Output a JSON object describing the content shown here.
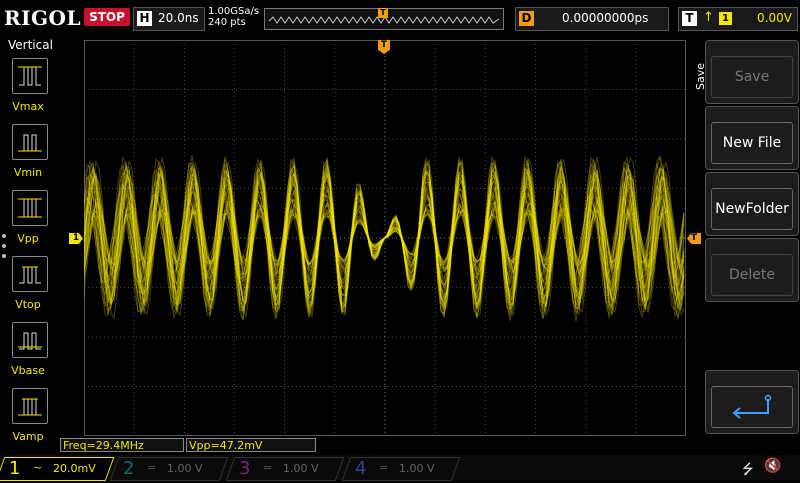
{
  "header": {
    "brand": "RIGOL",
    "run_state": "STOP",
    "horizontal": {
      "key": "H",
      "timebase": "20.0ns"
    },
    "sample_rate": "1.00GSa/s",
    "memory_depth": "240 pts",
    "trigger_pos_marker": "T",
    "delay": {
      "key": "D",
      "value": "0.00000000ps"
    },
    "trigger": {
      "key": "T",
      "edge": "↑",
      "source": "1",
      "level": "0.00V"
    }
  },
  "left_menu": {
    "title": "Vertical",
    "items": [
      {
        "label": "Vmax"
      },
      {
        "label": "Vmin"
      },
      {
        "label": "Vpp"
      },
      {
        "label": "Vtop"
      },
      {
        "label": "Vbase"
      },
      {
        "label": "Vamp"
      }
    ]
  },
  "markers": {
    "ch1": "1",
    "trigger_level": "T",
    "trigger_time": "T"
  },
  "right_menu": {
    "title": "Save",
    "buttons": [
      {
        "label": "Save",
        "enabled": false
      },
      {
        "label": "New File",
        "enabled": true
      },
      {
        "label": "NewFolder",
        "enabled": true
      },
      {
        "label": "Delete",
        "enabled": false
      }
    ],
    "back_icon": "return-arrow-icon"
  },
  "measurements": [
    {
      "text": "Freq=29.4MHz"
    },
    {
      "text": "Vpp=47.2mV"
    }
  ],
  "channels": [
    {
      "num": "1",
      "coupling": "~",
      "scale": "20.0mV",
      "color": "#f3e600",
      "active": true
    },
    {
      "num": "2",
      "coupling": "=",
      "scale": "1.00 V",
      "color": "#00a0a0",
      "active": false
    },
    {
      "num": "3",
      "coupling": "=",
      "scale": "1.00 V",
      "color": "#c040c0",
      "active": false
    },
    {
      "num": "4",
      "coupling": "=",
      "scale": "1.00 V",
      "color": "#3a6ad0",
      "active": false
    }
  ],
  "status_icons": [
    "usb-icon",
    "speaker-muted-icon"
  ],
  "colors": {
    "ch1": "#f3e600",
    "trigger": "#f39c12",
    "stop": "#c8102e",
    "grid": "#555555"
  }
}
